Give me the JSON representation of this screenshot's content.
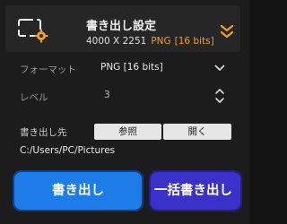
{
  "header": {
    "title": "書き出し設定",
    "size_text": "4000 X 2251",
    "format": "PNG",
    "bits": "[16 bits]",
    "export_icon": "monitor-gear-icon",
    "collapse_icon": "double-chevron-down-icon"
  },
  "format_row": {
    "label": "フォーマット",
    "value": "PNG   [16 bits]",
    "icon": "chevron-down-icon"
  },
  "level_row": {
    "label": "レベル",
    "value": "3",
    "icon": "spin-arrows-icon"
  },
  "destination": {
    "label": "書き出し先",
    "browse_label": "参照",
    "open_label": "開く",
    "path": "C:/Users/PC/Pictures"
  },
  "actions": {
    "export_label": "書き出し",
    "batch_label": "一括書き出し"
  },
  "colors": {
    "accent_orange": "#f0a020",
    "export_blue": "#1e7ce8",
    "batch_purple": "#3a32c8"
  }
}
